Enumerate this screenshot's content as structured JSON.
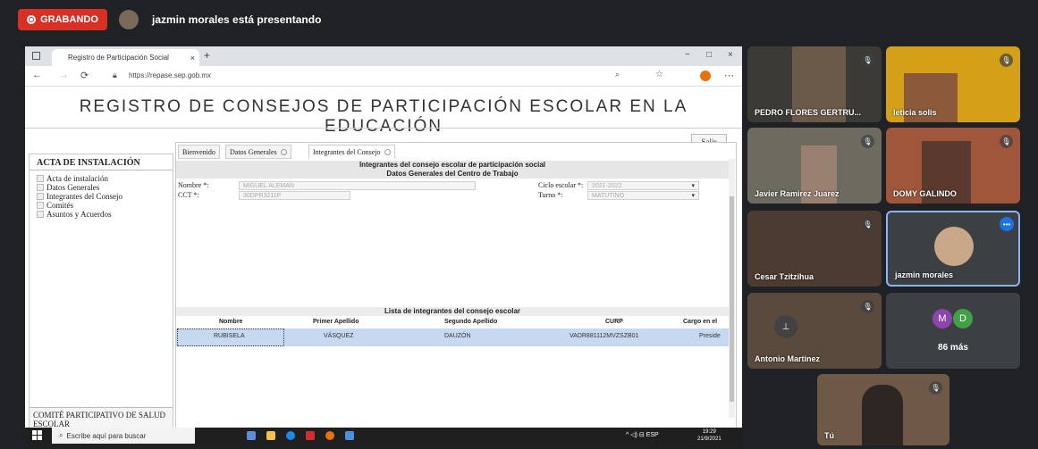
{
  "meet": {
    "recording_label": "GRABANDO",
    "presenter_text": "jazmin morales está presentando",
    "participants": [
      {
        "name": "PEDRO FLORES GERTRU...",
        "muted": true
      },
      {
        "name": "leticia solis",
        "muted": true
      },
      {
        "name": "Javier Ramirez Juarez",
        "muted": true
      },
      {
        "name": "DOMY GALINDO",
        "muted": true
      },
      {
        "name": "Cesar Tzitzihua",
        "muted": true
      },
      {
        "name": "jazmin morales",
        "muted": false
      },
      {
        "name": "Antonio Martinez",
        "muted": true
      },
      {
        "name": "Tú",
        "muted": true
      }
    ],
    "more_avatars": [
      "M",
      "D"
    ],
    "more_label": "86 más"
  },
  "browser": {
    "tab_title": "Registro de Participación Social",
    "new_tab": "+",
    "url": "https://repase.sep.gob.mx",
    "window_controls": [
      "−",
      "□",
      "×"
    ]
  },
  "site": {
    "title": "REGISTRO DE CONSEJOS DE PARTICIPACIÓN ESCOLAR EN LA EDUCACIÓN",
    "salir": "Salir",
    "sidebar_title": "ACTA DE INSTALACIÓN",
    "sidebar_items": [
      "Acta de instalación",
      "Datos Generales",
      "Integrantes del Consejo",
      "Comités",
      "Asuntos y Acuerdos"
    ],
    "sidebar_footer": "COMITÉ PARTICIPATIVO DE SALUD ESCOLAR",
    "tabs": [
      "Bienvenido",
      "Datos Generales",
      "Integrantes del Consejo"
    ],
    "heading1": "Integrantes del consejo escolar de participación social",
    "heading2": "Datos Generales del Centro de Trabajo",
    "nombre_label": "Nombre *:",
    "nombre_value": "MIGUEL ALEMAN",
    "cct_label": "CCT *:",
    "cct_value": "30DPR3211P",
    "ciclo_label": "Ciclo escolar *:",
    "ciclo_value": "2021-2022",
    "turno_label": "Turno *:",
    "turno_value": "MATUTINO",
    "list_heading": "Lista de integrantes del consejo escolar",
    "columns": [
      "Nombre",
      "Primer Apellido",
      "Segundo Apellido",
      "CURP",
      "Cargo en el"
    ],
    "row": [
      "RUBISELA",
      "VÁSQUEZ",
      "DAUZÓN",
      "VADR881112MVZSZB01",
      "Preside"
    ]
  },
  "taskbar": {
    "search_placeholder": "Escribe aquí para buscar",
    "lang": "ESP",
    "time": "19:29",
    "date": "21/9/2021"
  }
}
